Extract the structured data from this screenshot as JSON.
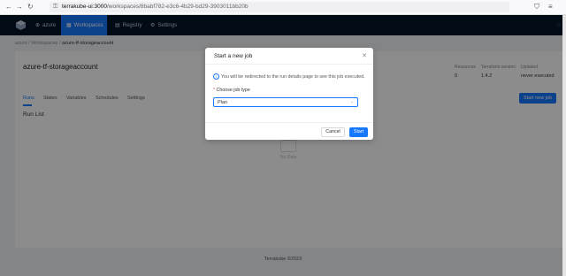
{
  "browser": {
    "url_host": "terrakube-ui:3000",
    "url_path": "/workspaces/8babf782-e3c6-4b29-bd29-3903011bb20b"
  },
  "topnav": {
    "org": "azure",
    "items": [
      {
        "label": "Workspaces",
        "active": true
      },
      {
        "label": "Registry",
        "active": false
      },
      {
        "label": "Settings",
        "active": false
      }
    ]
  },
  "breadcrumb": [
    "azure",
    "Workspaces",
    "azure-tf-storageaccount"
  ],
  "workspace": {
    "name": "azure-tf-storageaccount",
    "stats": [
      {
        "label": "Resources",
        "value": "0"
      },
      {
        "label": "Terraform version",
        "value": "1.4.2"
      },
      {
        "label": "Updated",
        "value": "never executed"
      }
    ],
    "tabs": [
      "Runs",
      "States",
      "Variables",
      "Schedules",
      "Settings"
    ],
    "active_tab": "Runs",
    "start_job_label": "Start new job",
    "run_list_title": "Run List",
    "no_data": "No Data"
  },
  "footer": "Terrakube ©2023",
  "modal": {
    "title": "Start a new job",
    "info": "You will be redirected to the run details page to see this job executed.",
    "field_label": "Choose job type",
    "field_value": "Plan",
    "cancel_label": "Cancel",
    "start_label": "Start"
  },
  "colors": {
    "accent": "#1677ff",
    "nav_bg": "#001529"
  }
}
